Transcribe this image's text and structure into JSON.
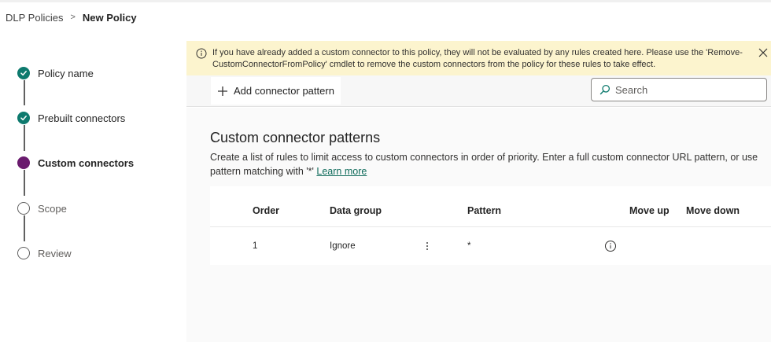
{
  "breadcrumb": {
    "parent": "DLP Policies",
    "separator": ">",
    "current": "New Policy"
  },
  "steps": [
    {
      "label": "Policy name",
      "status": "done"
    },
    {
      "label": "Prebuilt connectors",
      "status": "done"
    },
    {
      "label": "Custom connectors",
      "status": "active"
    },
    {
      "label": "Scope",
      "status": "todo"
    },
    {
      "label": "Review",
      "status": "todo"
    }
  ],
  "banner": {
    "line1": "If you have already added a custom connector to this policy, they will not be evaluated by any rules created here. Please use the 'Remove-",
    "line2": "CustomConnectorFromPolicy' cmdlet to remove the custom connectors from the policy for these rules to take effect.",
    "icon": "info-icon"
  },
  "toolbar": {
    "add_label": "Add connector pattern",
    "search_placeholder": "Search"
  },
  "section": {
    "title": "Custom connector patterns",
    "description": "Create a list of rules to limit access to custom connectors in order of priority. Enter a full custom connector URL pattern, or use pattern matching with '*'",
    "learn_more": "Learn more"
  },
  "table": {
    "headers": {
      "order": "Order",
      "data_group": "Data group",
      "pattern": "Pattern",
      "move_up": "Move up",
      "move_down": "Move down"
    },
    "rows": [
      {
        "order": "1",
        "data_group": "Ignore",
        "pattern": "*"
      }
    ]
  },
  "colors": {
    "done": "#0e7a6e",
    "active": "#6a1b6e",
    "banner_bg": "#fcf4ce",
    "link": "#0f6b5b"
  }
}
